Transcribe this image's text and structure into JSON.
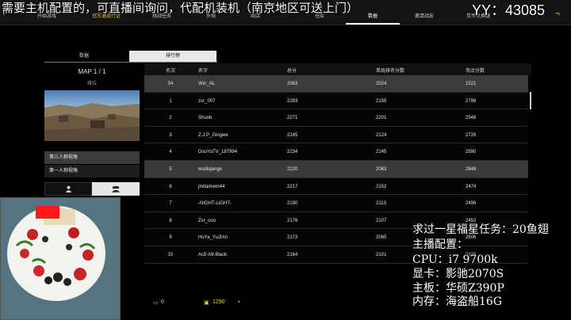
{
  "nav": {
    "tabs": [
      {
        "label": "开始游戏"
      },
      {
        "label": "冠军通道行证"
      },
      {
        "label": "挑战任务"
      },
      {
        "label": "外观"
      },
      {
        "label": "商店"
      },
      {
        "label": "仓库"
      },
      {
        "label": "数据"
      },
      {
        "label": "邀请战友"
      },
      {
        "label": "货币兑换器"
      }
    ],
    "active_tab": "数据",
    "highlight_color": "#e8c33a"
  },
  "left_panel": {
    "tab_data": "数据",
    "tab_rank": "排行榜",
    "map_title": "MAP 1 / 1",
    "map_sub": "排位",
    "view_third": "第三人称视角",
    "view_first": "第一人称视角",
    "solo_icon": "person-icon",
    "team_icon": "team-icon"
  },
  "table": {
    "headers": {
      "rank": "名次",
      "name": "名字",
      "total": "总分",
      "single": "单局排名分数",
      "elim": "淘汰分数"
    },
    "rows": [
      {
        "rank": "54",
        "name": "Win_AL",
        "total": "2063",
        "single": "2024",
        "elim": "2221"
      },
      {
        "rank": "1",
        "name": "zsr_007",
        "total": "2283",
        "single": "2155",
        "elim": "2796"
      },
      {
        "rank": "2",
        "name": "Shuob",
        "total": "2271",
        "single": "2201",
        "elim": "2548"
      },
      {
        "rank": "3",
        "name": "Z.J.P_Gingwe",
        "total": "2245",
        "single": "2124",
        "elim": "2726"
      },
      {
        "rank": "4",
        "name": "DouYuTV_187994",
        "total": "2234",
        "single": "2145",
        "elim": "2590"
      },
      {
        "rank": "5",
        "name": "wudiqiangx",
        "total": "2220",
        "single": "2063",
        "elim": "2848"
      },
      {
        "rank": "6",
        "name": "jinitaimein44",
        "total": "2217",
        "single": "2152",
        "elim": "2474"
      },
      {
        "rank": "7",
        "name": "-NIGHT-LIGHT-",
        "total": "2190",
        "single": "2113",
        "elim": "2496"
      },
      {
        "rank": "8",
        "name": "Zsr_ooo",
        "total": "2176",
        "single": "2107",
        "elim": "2452"
      },
      {
        "rank": "9",
        "name": "HuYa_YuJIAn",
        "total": "2173",
        "single": "2065",
        "elim": "2606"
      },
      {
        "rank": "10",
        "name": "AcE-Mr.Black",
        "total": "2164",
        "single": "2101",
        "elim": "2420"
      }
    ]
  },
  "bottom": {
    "currency1": "0",
    "currency2": "1290"
  },
  "overlay": {
    "top_text": "需要主机配置的，可直播间询问，代配机装机（南京地区可送上门）",
    "yy": "YY：43085",
    "line1": "求过一星福星任务：20鱼翅",
    "line2": "主播配置：",
    "line3": "CPU：i7 9700k",
    "line4": "显卡：影驰2070S",
    "line5": "主板：华硕Z390P",
    "line6": "内存：海盗船16G"
  }
}
